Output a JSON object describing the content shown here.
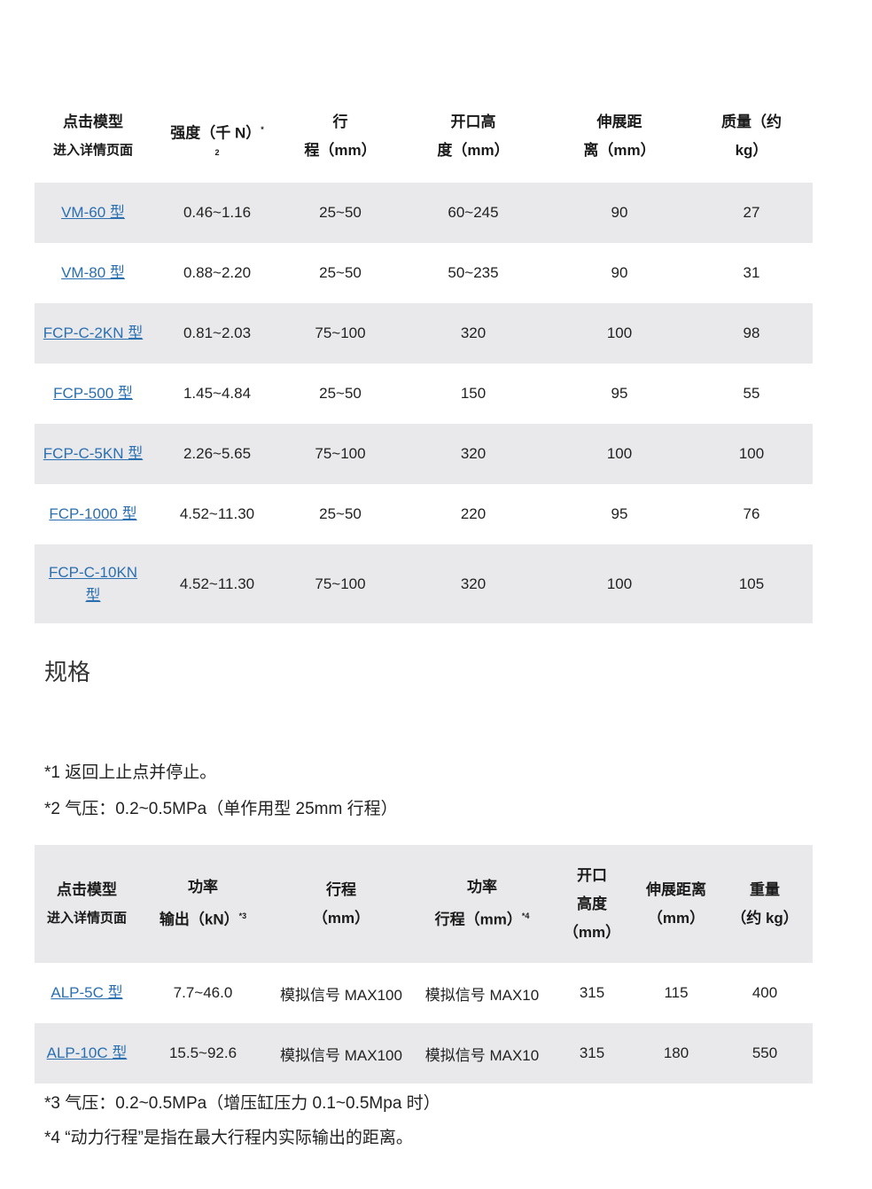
{
  "table1": {
    "headers": {
      "model_line1": "点击模型",
      "model_line2": "进入详情页面",
      "strength": "强度（千 N）",
      "strength_sup1": "*",
      "strength_sup2": "2",
      "stroke_line1": "行",
      "stroke_line2": "程（mm）",
      "opening_line1": "开口高",
      "opening_line2": "度（mm）",
      "extension_line1": "伸展距",
      "extension_line2": "离（mm）",
      "mass_line1": "质量（约",
      "mass_line2": "kg）"
    },
    "rows": [
      {
        "model": "VM-60 型",
        "strength": "0.46~1.16",
        "stroke": "25~50",
        "opening": "60~245",
        "extension": "90",
        "mass": "27"
      },
      {
        "model": "VM-80 型",
        "strength": "0.88~2.20",
        "stroke": "25~50",
        "opening": "50~235",
        "extension": "90",
        "mass": "31"
      },
      {
        "model": "FCP-C-2KN 型",
        "strength": "0.81~2.03",
        "stroke": "75~100",
        "opening": "320",
        "extension": "100",
        "mass": "98"
      },
      {
        "model": "FCP-500 型",
        "strength": "1.45~4.84",
        "stroke": "25~50",
        "opening": "150",
        "extension": "95",
        "mass": "55"
      },
      {
        "model": "FCP-C-5KN 型",
        "strength": "2.26~5.65",
        "stroke": "75~100",
        "opening": "320",
        "extension": "100",
        "mass": "100"
      },
      {
        "model": "FCP-1000 型",
        "strength": "4.52~11.30",
        "stroke": "25~50",
        "opening": "220",
        "extension": "95",
        "mass": "76"
      },
      {
        "model_line1": "FCP-C-10KN",
        "model_line2": "型",
        "strength": "4.52~11.30",
        "stroke": "75~100",
        "opening": "320",
        "extension": "100",
        "mass": "105"
      }
    ]
  },
  "section_title": "规格",
  "notes_top": [
    "*1 返回上止点并停止。",
    "*2 气压：0.2~0.5MPa（单作用型 25mm 行程）"
  ],
  "table2": {
    "headers": {
      "model_line1": "点击模型",
      "model_line2": "进入详情页面",
      "power_line1": "功率",
      "power_line2": "输出（kN）",
      "power_sup": "*3",
      "stroke_line1": "行程",
      "stroke_line2": "（mm）",
      "power_stroke_line1": "功率",
      "power_stroke_line2": "行程（mm）",
      "power_stroke_sup": "*4",
      "opening_line1": "开口",
      "opening_line2": "高度",
      "opening_line3": "（mm）",
      "extension_line1": "伸展距离",
      "extension_line2": "（mm）",
      "weight_line1": "重量",
      "weight_line2": "（约 kg）"
    },
    "rows": [
      {
        "model": "ALP-5C 型",
        "power": "7.7~46.0",
        "stroke": "模拟信号 MAX100",
        "power_stroke": "模拟信号 MAX10",
        "opening": "315",
        "extension": "115",
        "weight": "400"
      },
      {
        "model": "ALP-10C 型",
        "power": "15.5~92.6",
        "stroke": "模拟信号 MAX100",
        "power_stroke": "模拟信号 MAX10",
        "opening": "315",
        "extension": "180",
        "weight": "550"
      }
    ]
  },
  "notes_bottom": [
    "*3 气压：0.2~0.5MPa（增压缸压力 0.1~0.5Mpa 时）",
    "*4 “动力行程”是指在最大行程内实际输出的距离。"
  ],
  "colors": {
    "link": "#2a6fb0",
    "row_shade": "#e9e9ec"
  }
}
